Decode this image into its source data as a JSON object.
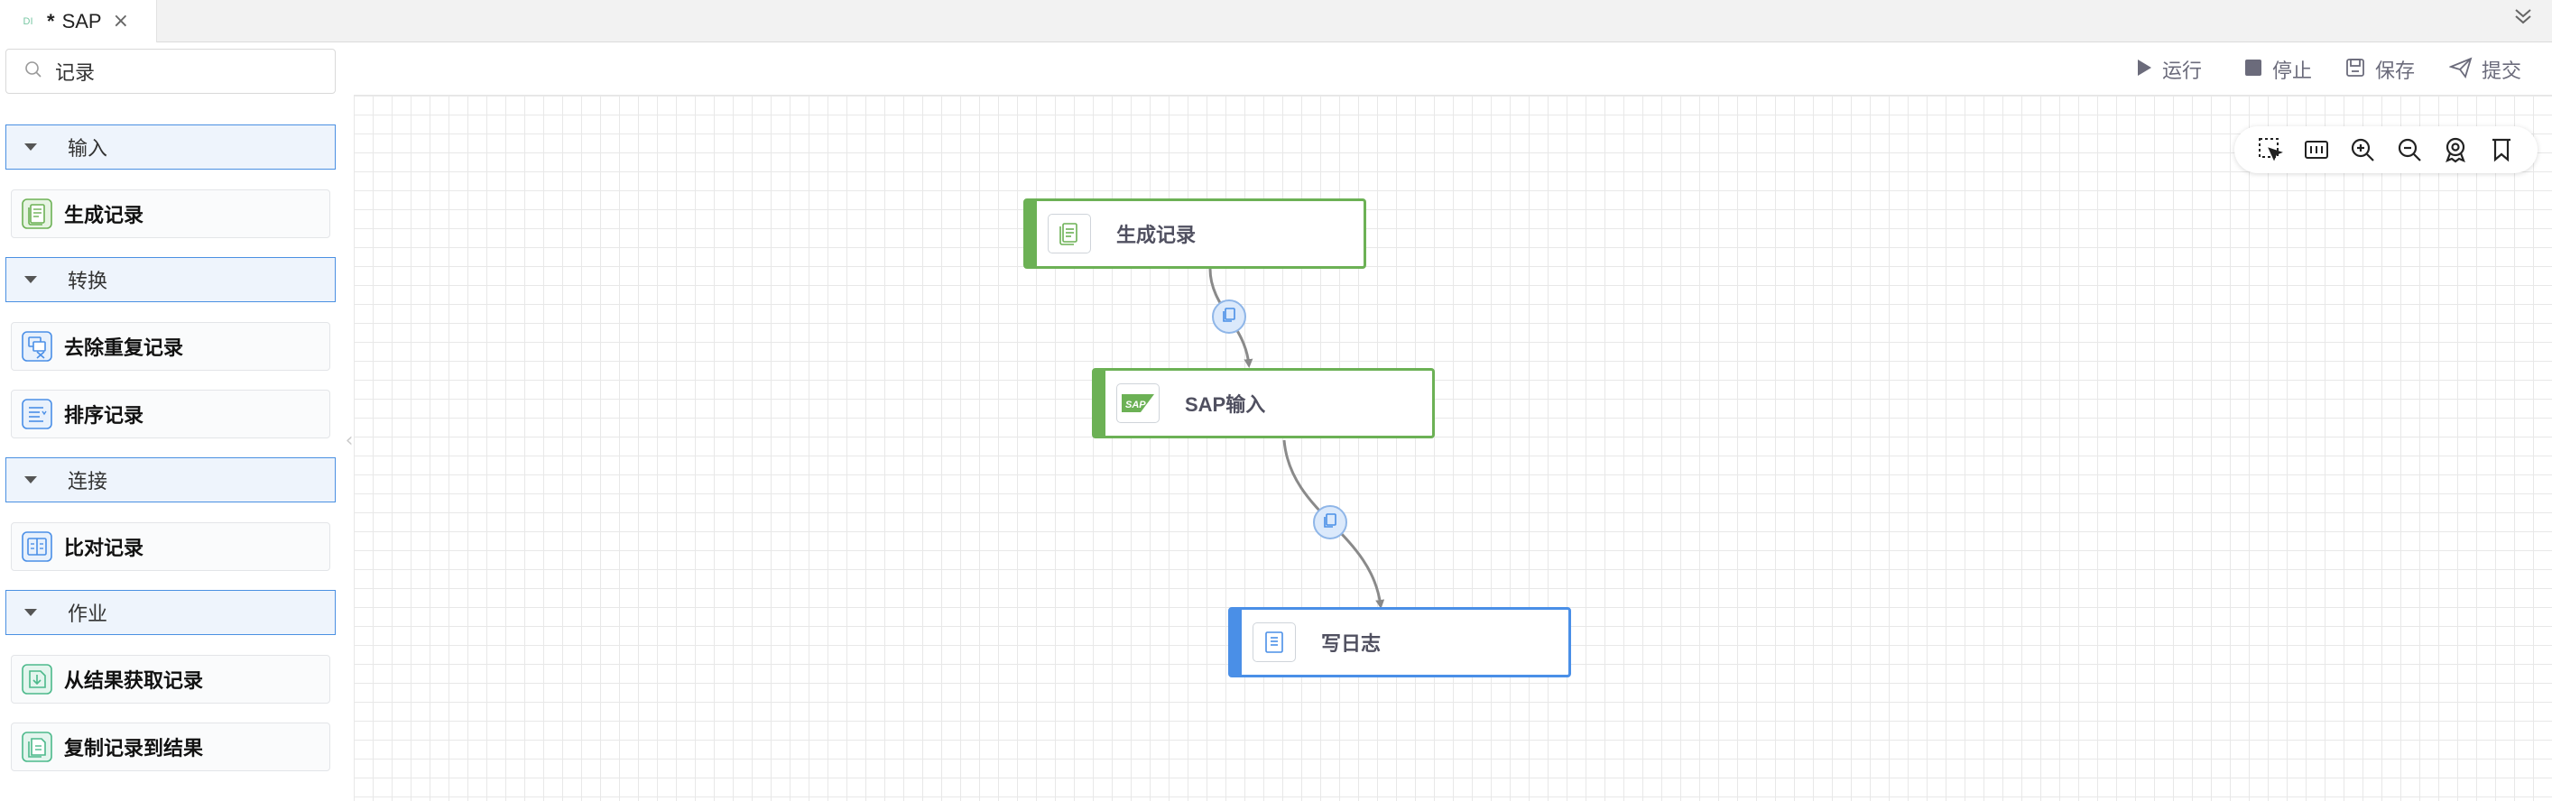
{
  "tab": {
    "icon_text": "DI",
    "modified_mark": "*",
    "title": "SAP",
    "close_glyph": "×"
  },
  "search": {
    "value": "记录",
    "placeholder": ""
  },
  "sidebar": {
    "categories": [
      {
        "label": "输入"
      },
      {
        "label": "转换"
      },
      {
        "label": "连接"
      },
      {
        "label": "作业"
      }
    ],
    "items": [
      {
        "label": "生成记录",
        "icon": "generate-records-icon"
      },
      {
        "label": "去除重复记录",
        "icon": "remove-duplicates-icon"
      },
      {
        "label": "排序记录",
        "icon": "sort-records-icon"
      },
      {
        "label": "比对记录",
        "icon": "compare-records-icon"
      },
      {
        "label": "从结果获取记录",
        "icon": "get-records-from-result-icon"
      },
      {
        "label": "复制记录到结果",
        "icon": "copy-records-to-result-icon"
      }
    ],
    "collapse_glyph": "‹"
  },
  "toolbar": {
    "run_label": "运行",
    "stop_label": "停止",
    "save_label": "保存",
    "submit_label": "提交"
  },
  "canvas_tools": [
    "select-icon",
    "fit-icon",
    "zoom-in-icon",
    "zoom-out-icon",
    "locate-icon",
    "bookmark-icon"
  ],
  "nodes": [
    {
      "label": "生成记录",
      "type": "input",
      "status_color": "#6cb155"
    },
    {
      "label": "SAP输入",
      "type": "input",
      "status_color": "#6cb155"
    },
    {
      "label": "写日志",
      "type": "output",
      "status_color": "#4a8fe7"
    }
  ],
  "colors": {
    "accent_blue": "#4a90e2",
    "node_green": "#6cb155",
    "node_blue": "#4a8fe7",
    "toolbar_text": "#6b6b7b"
  }
}
